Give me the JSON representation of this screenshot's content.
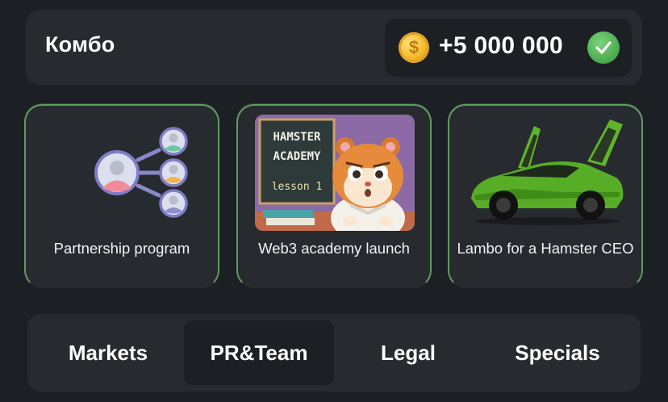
{
  "combo": {
    "title": "Комбо",
    "reward": "+5 000 000",
    "reward_icon": "coin-icon",
    "status_icon": "check-icon",
    "accent_color": "#4aa94c"
  },
  "cards": [
    {
      "label": "Partnership program",
      "image": "partnership-network-illustration",
      "selected": true
    },
    {
      "label": "Web3 academy launch",
      "image": "hamster-academy-illustration",
      "image_text": [
        "HAMSTER",
        "ACADEMY",
        "lesson 1"
      ],
      "selected": true
    },
    {
      "label": "Lambo for a Hamster CEO",
      "image": "green-lamborghini-illustration",
      "selected": true
    }
  ],
  "tabs": [
    {
      "label": "Markets",
      "active": false
    },
    {
      "label": "PR&Team",
      "active": true
    },
    {
      "label": "Legal",
      "active": false
    },
    {
      "label": "Specials",
      "active": false
    }
  ]
}
